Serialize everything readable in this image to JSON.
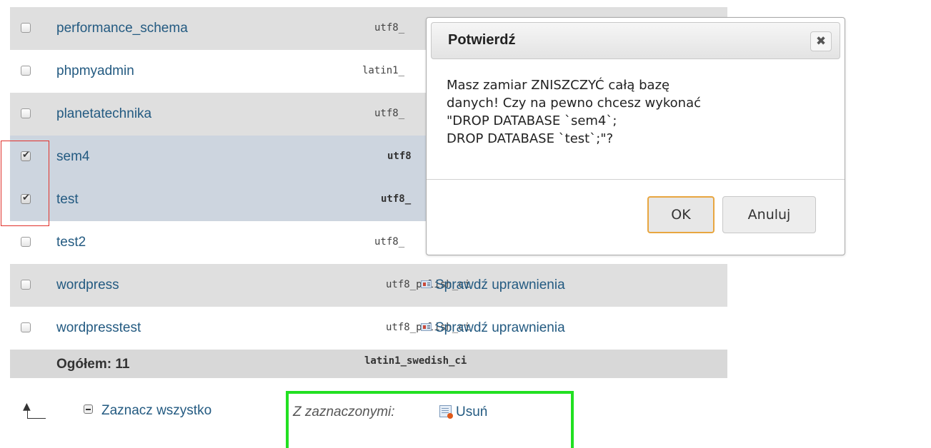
{
  "databases": [
    {
      "name": "performance_schema",
      "collation": "utf8_",
      "checked": false,
      "privileges": ""
    },
    {
      "name": "phpmyadmin",
      "collation": "latin1_",
      "checked": false,
      "privileges": ""
    },
    {
      "name": "planetatechnika",
      "collation": "utf8_",
      "checked": false,
      "privileges": ""
    },
    {
      "name": "sem4",
      "collation": "utf8",
      "checked": true,
      "privileges": ""
    },
    {
      "name": "test",
      "collation": "utf8_",
      "checked": true,
      "privileges": ""
    },
    {
      "name": "test2",
      "collation": "utf8_",
      "checked": false,
      "privileges": ""
    },
    {
      "name": "wordpress",
      "collation": "utf8_polish_ci",
      "checked": false,
      "privileges": "Sprawdź uprawnienia"
    },
    {
      "name": "wordpresstest",
      "collation": "utf8_polish_ci",
      "checked": false,
      "privileges": "Sprawdź uprawnienia"
    }
  ],
  "footer": {
    "total": "Ogółem: 11",
    "collation": "latin1_swedish_ci"
  },
  "bottom": {
    "select_all": "Zaznacz wszystko",
    "with_selected": "Z zaznaczonymi:",
    "delete": "Usuń"
  },
  "dialog": {
    "title": "Potwierdź",
    "message": "Masz zamiar ZNISZCZYĆ całą bazę\ndanych! Czy na pewno chcesz wykonać\n\"DROP DATABASE `sem4`;\nDROP DATABASE `test`;\"?",
    "ok": "OK",
    "cancel": "Anuluj",
    "close_icon": "close-icon"
  },
  "colors": {
    "link": "#235a81",
    "highlight_red": "#e0302a",
    "highlight_green": "#22e022",
    "ok_border": "#e8a640"
  }
}
